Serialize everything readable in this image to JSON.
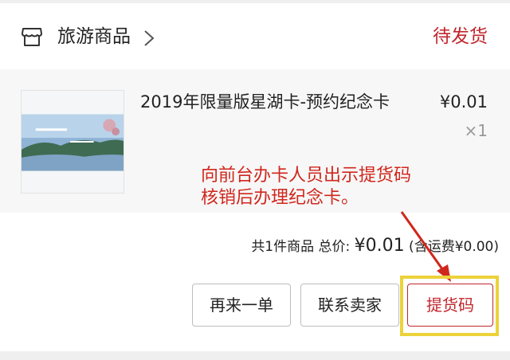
{
  "shop": {
    "name": "旅游商品",
    "icon": "store-icon",
    "chevron": "chevron-right-icon"
  },
  "order": {
    "status": "待发货"
  },
  "product": {
    "name": "2019年限量版星湖卡-预约纪念卡",
    "price": "¥0.01",
    "quantity": "×1",
    "image": "card-thumbnail"
  },
  "annotation": {
    "line1": "向前台办卡人员出示提货码",
    "line2": "核销后办理纪念卡。",
    "color": "#d0271d"
  },
  "summary": {
    "count_text": "共1件商品 总价: ",
    "total": "¥0.01",
    "shipping_text": " (含运费¥0.00)"
  },
  "actions": {
    "reorder": "再来一单",
    "contact_seller": "联系卖家",
    "pickup_code": "提货码"
  },
  "colors": {
    "accent": "#c0272d",
    "highlight": "#ecd23a"
  }
}
